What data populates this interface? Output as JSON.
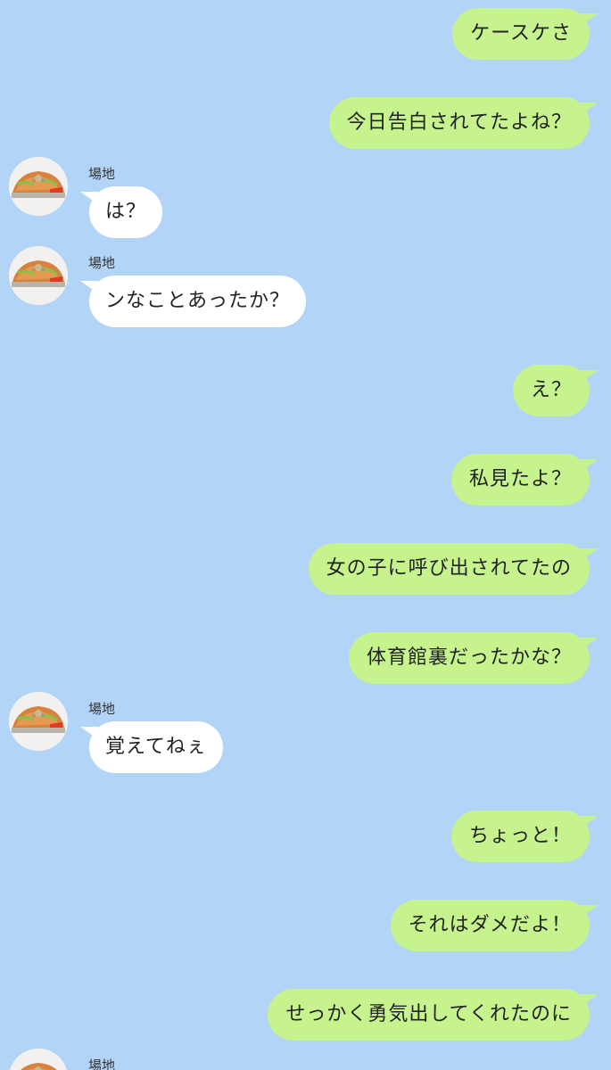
{
  "sender_name": "場地",
  "messages": {
    "m1": "ケースケさ",
    "m2": "今日告白されてたよね？",
    "m3": "は？",
    "m4": "ンなことあったか？",
    "m5": "え？",
    "m6": "私見たよ？",
    "m7": "女の子に呼び出されてたの",
    "m8": "体育館裏だったかな？",
    "m9": "覚えてねぇ",
    "m10": "ちょっと！",
    "m11": "それはダメだよ！",
    "m12": "せっかく勇気出してくれたのに"
  },
  "colors": {
    "background": "#b2d4f6",
    "outgoing_bubble": "#c6f38e",
    "incoming_bubble": "#ffffff"
  },
  "icons": {
    "avatar": "food-avatar-icon"
  }
}
